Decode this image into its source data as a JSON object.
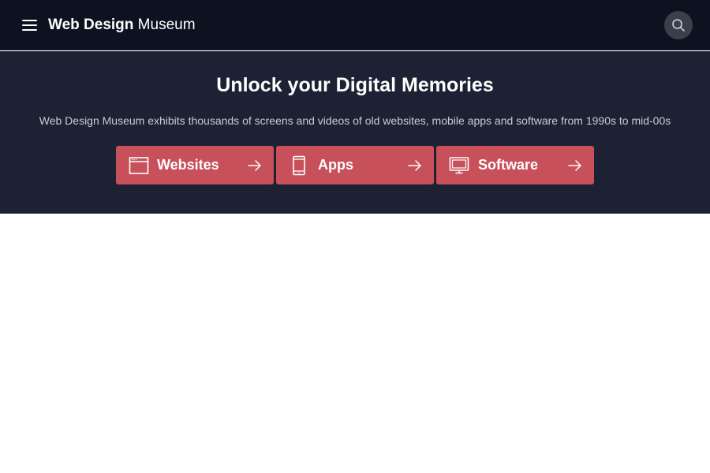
{
  "header": {
    "brand_bold": "Web Design",
    "brand_light": "Museum",
    "menu_icon": "hamburger-menu-icon",
    "search_icon": "search-icon"
  },
  "hero": {
    "title": "Unlock your Digital Memories",
    "subtitle": "Web Design Museum exhibits thousands of screens and videos of old websites, mobile apps and software from 1990s to mid-00s",
    "buttons": [
      {
        "label": "Websites",
        "icon": "browser-window-icon"
      },
      {
        "label": "Apps",
        "icon": "mobile-phone-icon"
      },
      {
        "label": "Software",
        "icon": "desktop-monitor-icon"
      }
    ]
  },
  "colors": {
    "topbar_bg": "#0d1220",
    "hero_bg": "#1c2233",
    "accent": "#c8505a"
  }
}
